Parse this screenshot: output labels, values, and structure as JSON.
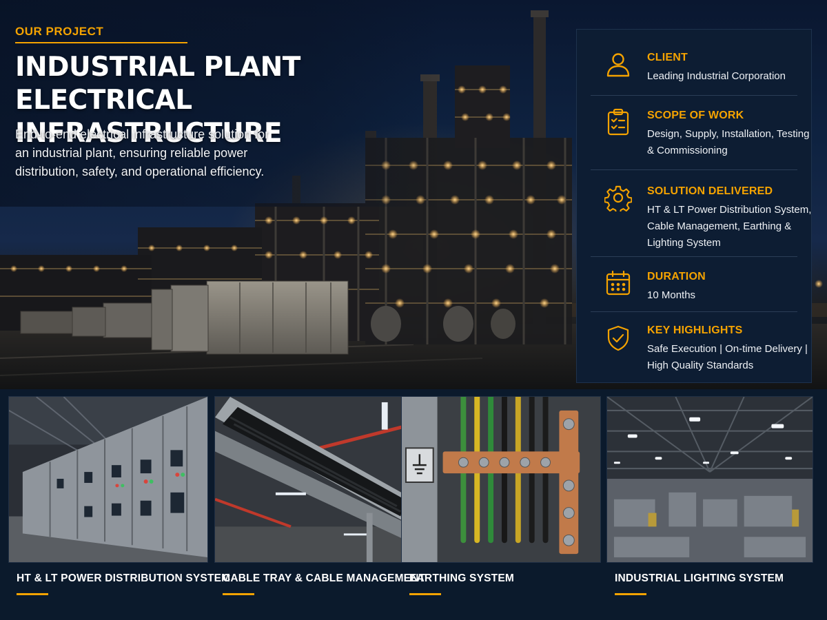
{
  "hero": {
    "eyebrow": "OUR PROJECT",
    "title_line1": "INDUSTRIAL PLANT",
    "title_line2": "ELECTRICAL INFRASTRUCTURE",
    "description": "End-to-end electrical infrastructure solution for an industrial plant, ensuring reliable power distribution, safety, and operational efficiency."
  },
  "info": [
    {
      "icon": "user-icon",
      "label": "CLIENT",
      "value": "Leading Industrial Corporation"
    },
    {
      "icon": "clipboard-checklist-icon",
      "label": "SCOPE OF WORK",
      "value": "Design, Supply, Installation, Testing & Commissioning"
    },
    {
      "icon": "gear-icon",
      "label": "SOLUTION DELIVERED",
      "value": "HT & LT Power Distribution System, Cable Management, Earthing & Lighting System"
    },
    {
      "icon": "calendar-icon",
      "label": "DURATION",
      "value": "10 Months"
    },
    {
      "icon": "shield-check-icon",
      "label": "KEY HIGHLIGHTS",
      "value": "Safe Execution | On-time Delivery | High Quality Standards"
    }
  ],
  "gallery": [
    {
      "label": "HT & LT POWER DISTRIBUTION SYSTEM"
    },
    {
      "label": "CABLE TRAY & CABLE MANAGEMENT"
    },
    {
      "label": "EARTHING SYSTEM"
    },
    {
      "label": "INDUSTRIAL LIGHTING SYSTEM"
    }
  ],
  "colors": {
    "accent": "#f5a300",
    "background": "#0b1a2c",
    "panel": "#0d1d33"
  }
}
